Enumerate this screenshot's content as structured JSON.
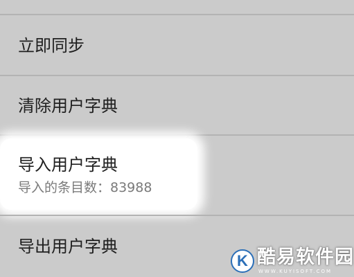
{
  "settings": {
    "items": [
      {
        "title": "立即同步"
      },
      {
        "title": "清除用户字典"
      },
      {
        "title": "导入用户字典",
        "summary": "导入的条目数：83988"
      },
      {
        "title": "导出用户字典"
      }
    ]
  },
  "watermark": {
    "logo_letter": "K",
    "text": "酷易软件园",
    "url": "WWW.KUYISOFT.COM"
  }
}
